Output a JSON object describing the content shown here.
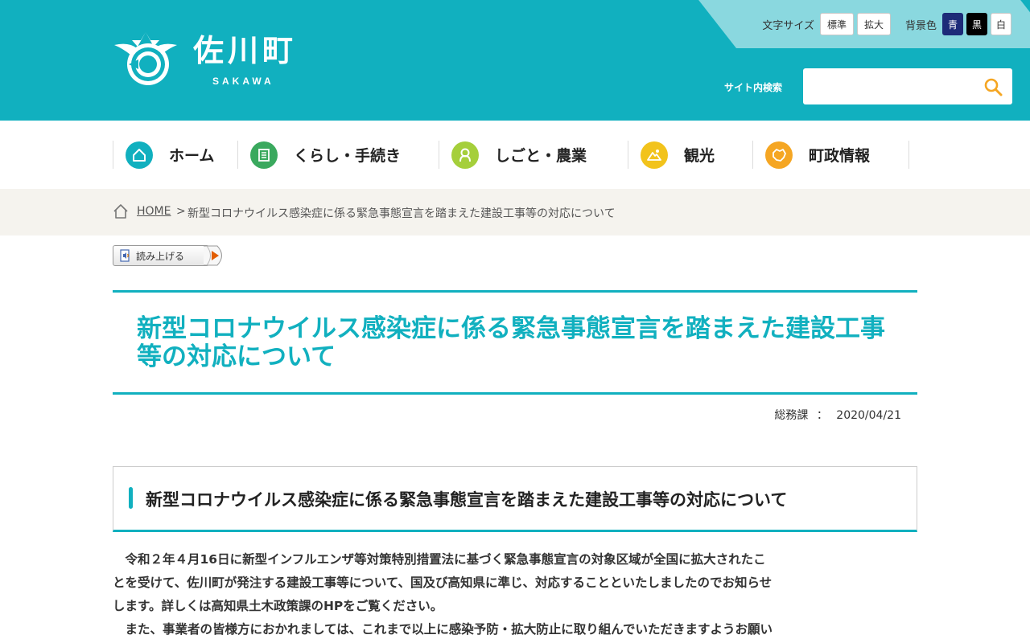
{
  "header": {
    "site_name": "佐川町",
    "site_name_romaji": "SAKAWA",
    "text_size_label": "文字サイズ",
    "text_size_standard": "標準",
    "text_size_large": "拡大",
    "bg_color_label": "背景色",
    "bg_blue": "青",
    "bg_black": "黒",
    "bg_white": "白",
    "search_label": "サイト内検索",
    "search_placeholder": ""
  },
  "nav": {
    "items": [
      {
        "label": "ホーム",
        "icon": "home-icon"
      },
      {
        "label": "くらし・手続き",
        "icon": "document-icon"
      },
      {
        "label": "しごと・農業",
        "icon": "person-icon"
      },
      {
        "label": "観光",
        "icon": "mountain-icon"
      },
      {
        "label": "町政情報",
        "icon": "map-icon"
      }
    ]
  },
  "breadcrumb": {
    "home": "HOME",
    "separator": ">",
    "current": "新型コロナウイルス感染症に係る緊急事態宣言を踏まえた建設工事等の対応について"
  },
  "readaloud": {
    "label": "読み上げる"
  },
  "page": {
    "title": "新型コロナウイルス感染症に係る緊急事態宣言を踏まえた建設工事等の対応について",
    "department": "総務課",
    "meta_separator": "：",
    "date": "2020/04/21"
  },
  "section": {
    "heading": "新型コロナウイルス感染症に係る緊急事態宣言を踏まえた建設工事等の対応について",
    "paragraph1": "令和２年４月16日に新型インフルエンザ等対策特別措置法に基づく緊急事態宣言の対象区域が全国に拡大されたことを受けて、佐川町が発注する建設工事等について、国及び高知県に準じ、対応することといたしましたのでお知らせします。詳しくは高知県土木政策課のHPをご覧ください。",
    "paragraph2": "また、事業者の皆様方におかれましては、これまで以上に感染予防・拡大防止に取り組んでいただきますようお願いいたします。"
  },
  "colors": {
    "accent": "#11b0bf",
    "nav_home": "#11b0bf",
    "nav_life": "#3aa95e",
    "nav_work": "#a5cf3b",
    "nav_tourism": "#f2c31c",
    "nav_govt": "#f5a623",
    "search_icon": "#f5a623"
  }
}
